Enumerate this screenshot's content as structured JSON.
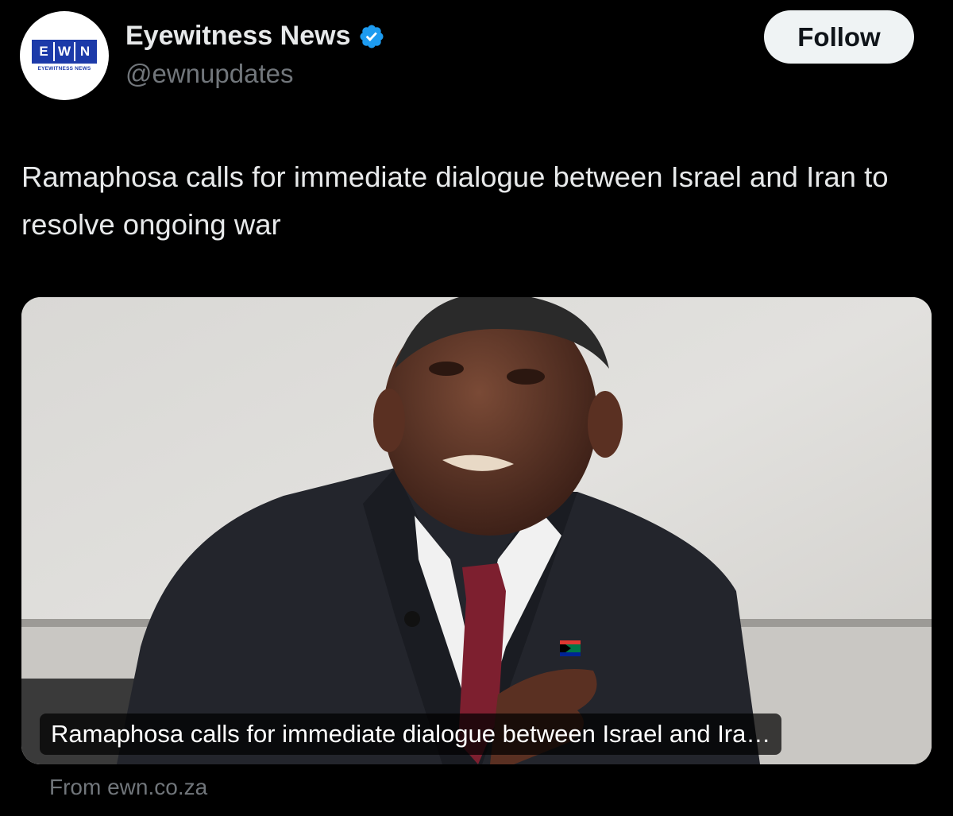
{
  "account": {
    "logo_letters": [
      "E",
      "W",
      "N"
    ],
    "logo_subtitle": "EYEWITNESS NEWS",
    "display_name": "Eyewitness News",
    "handle": "@ewnupdates",
    "verified": true,
    "verified_icon": "verified-badge-icon"
  },
  "follow_button": {
    "label": "Follow"
  },
  "tweet": {
    "text": "Ramaphosa calls for immediate dialogue between Israel and Iran to resolve ongoing war"
  },
  "link_card": {
    "caption": "Ramaphosa calls for immediate dialogue between Israel and Ira…",
    "source": "From ewn.co.za"
  },
  "colors": {
    "background": "#000000",
    "primary_text": "#e7e9ea",
    "secondary_text": "#71767b",
    "verified_blue": "#1d9bf0",
    "ewn_blue": "#1c3aa9",
    "follow_bg": "#eff3f4"
  }
}
